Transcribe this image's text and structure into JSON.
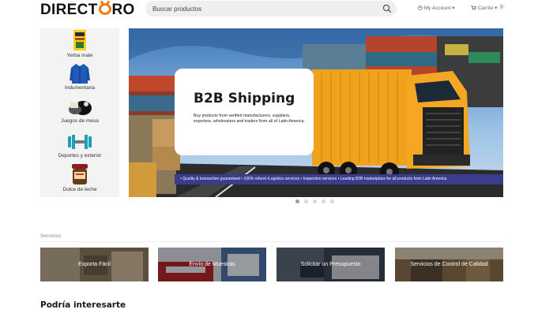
{
  "header": {
    "logo_left": "DIRECT",
    "logo_right": "RO",
    "search_placeholder": "Buscar productos",
    "account_label": "My Account",
    "cart_label": "Carrito",
    "cart_count": "0"
  },
  "sidebar": {
    "items": [
      {
        "label": "Yerba mate",
        "icon": "yerba-mate-package-icon"
      },
      {
        "label": "Indumentaria",
        "icon": "jacket-icon"
      },
      {
        "label": "Juegos de mesa",
        "icon": "board-game-icon"
      },
      {
        "label": "Deportes y exterior",
        "icon": "dumbbell-icon"
      },
      {
        "label": "Dulce de leche",
        "icon": "dulce-de-leche-jar-icon"
      }
    ]
  },
  "banner": {
    "title": "B2B Shipping",
    "body": "Buy products from verified manufacturers, suppliers, exporters, wholesalers and traders from all of Latin America.",
    "strip": "• Quality & transaction guaranteed • 100% refund •Logistics services • Inspection services • Leading B2B marketplace for all products from Latin America",
    "slides": 5,
    "active_slide": 1
  },
  "services": {
    "title": "Servicios",
    "tiles": [
      {
        "label": "Exporta Fácil"
      },
      {
        "label": "Envío de Muestras"
      },
      {
        "label": "Solicitar un Presupuesto"
      },
      {
        "label": "Servicios de Control de Calidad"
      }
    ]
  },
  "recommend": {
    "title": "Podría interesarte"
  },
  "colors": {
    "accent": "#f07b14",
    "strip": "#3b3c8f",
    "sidebar_bg": "#f3f3f3"
  }
}
